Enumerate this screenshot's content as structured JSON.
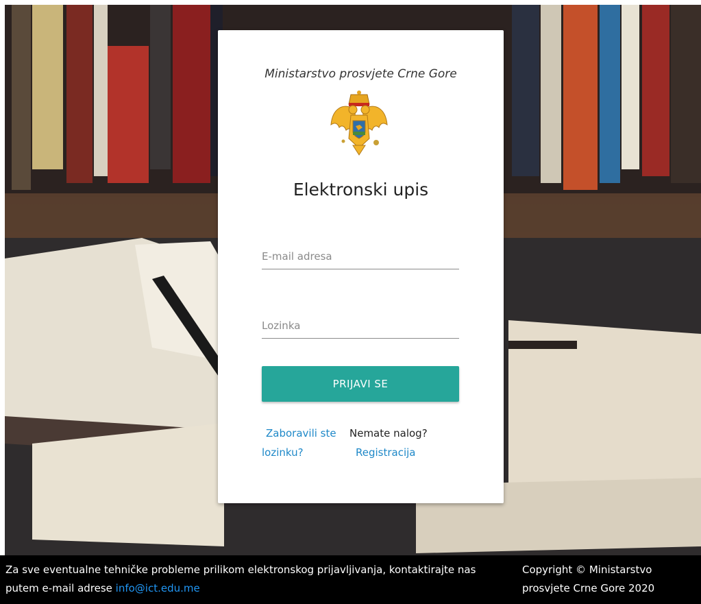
{
  "login": {
    "ministry_name": "Ministarstvo prosvjete Crne Gore",
    "title": "Elektronski upis",
    "email_placeholder": "E-mail adresa",
    "password_placeholder": "Lozinka",
    "submit_label": "PRIJAVI SE",
    "forgot_password_label": "Zaboravili ste lozinku?",
    "no_account_label": "Nemate nalog?",
    "register_label": "Registracija"
  },
  "footer": {
    "support_text": "Za sve eventualne tehničke probleme prilikom elektronskog prijavljivanja, kontaktirajte nas putem e-mail adrese",
    "support_email": "info@ict.edu.me",
    "copyright": "Copyright © Ministarstvo prosvjete Crne Gore 2020"
  },
  "icons": {
    "coat_of_arms": "montenegro-coat-of-arms-icon"
  },
  "colors": {
    "accent_button": "#26a69a",
    "link": "#1e88c8",
    "footer_background": "#000000",
    "footer_email_link": "#2196f3"
  }
}
